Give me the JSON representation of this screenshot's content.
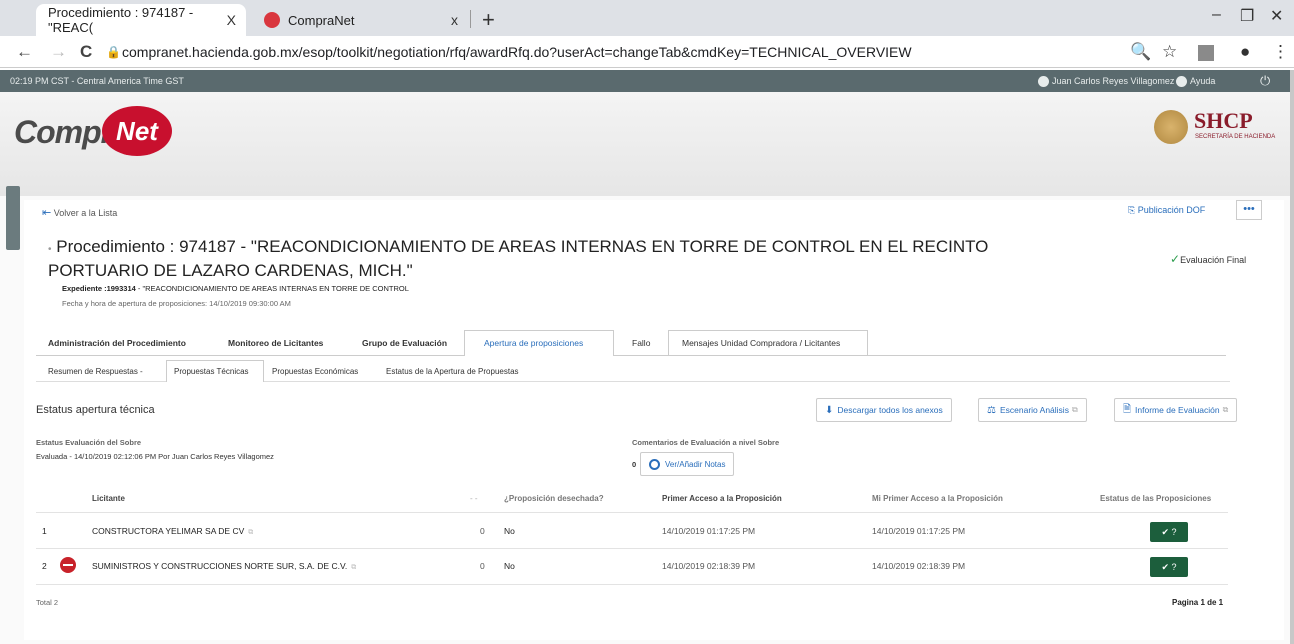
{
  "browser": {
    "tabs": [
      {
        "title": "Procedimiento : 974187 - \"REAC(",
        "close": "X"
      },
      {
        "title": "CompraNet",
        "close": "x"
      }
    ],
    "new_tab": "+",
    "window_controls": {
      "minimize": "‒",
      "restore": "❐",
      "close": "✕"
    },
    "nav": {
      "back": "←",
      "forward": "→",
      "reload": "C"
    },
    "url": "compranet.hacienda.gob.mx/esop/toolkit/negotiation/rfq/awardRfq.do?userAct=changeTab&cmdKey=TECHNICAL_OVERVIEW",
    "icons": {
      "search": "🔍",
      "star": "☆",
      "profile": "●",
      "menu": "⋮"
    }
  },
  "topstrip": {
    "time": "02:19 PM CST - Central America Time GST",
    "user": "Juan Carlos Reyes Villagomez",
    "help": "Ayuda",
    "power": "⏻"
  },
  "header": {
    "logo_left": "Compra",
    "logo_net": "Net",
    "agency": "SHCP",
    "agency_sub": "SECRETARÍA DE HACIENDA"
  },
  "nav": {
    "back_label": "Volver a la Lista",
    "publication": "Publicación DOF",
    "more": "•••"
  },
  "procedure": {
    "title": "Procedimiento : 974187 - \"REACONDICIONAMIENTO DE AREAS INTERNAS EN TORRE DE CONTROL EN EL RECINTO PORTUARIO DE LAZARO CARDENAS, MICH.\"",
    "status": "Evaluación Final",
    "exp_label": "Expediente :1993314",
    "exp_value": " - \"REACONDICIONAMIENTO DE AREAS INTERNAS EN TORRE DE CONTROL",
    "fecha": "Fecha y hora de apertura de proposiciones: 14/10/2019 09:30:00 AM"
  },
  "tabs": [
    "Administración del Procedimiento",
    "Monitoreo de Licitantes",
    "Grupo de Evaluación",
    "Apertura de proposiciones",
    "Fallo",
    "Mensajes Unidad Compradora / Licitantes"
  ],
  "subtabs": [
    "Resumen de Respuestas -",
    "Propuestas Técnicas",
    "Propuestas Económicas",
    "Estatus de la Apertura de Propuestas"
  ],
  "section": {
    "title": "Estatus apertura técnica",
    "btn_download": "Descargar todos los anexos",
    "btn_scenario": "Escenario Análisis",
    "btn_report": "Informe de Evaluación"
  },
  "evaluation": {
    "label": "Estatus Evaluación del Sobre",
    "value": "Evaluada - 14/10/2019 02:12:06 PM  Por Juan Carlos Reyes Villagomez",
    "comments_label": "Comentarios de Evaluación a nivel Sobre",
    "comments_count": "0",
    "notes_btn": "Ver/Añadir Notas"
  },
  "table": {
    "headers": {
      "licitante": "Licitante",
      "dash": "- -",
      "desechada": "¿Proposición desechada?",
      "primer_acceso": "Primer Acceso a la Proposición",
      "mi_primer_acceso": "Mi Primer Acceso a la Proposición",
      "estatus": "Estatus de las Proposiciones"
    },
    "rows": [
      {
        "num": "1",
        "name": "CONSTRUCTORA YELIMAR SA DE CV",
        "count": "0",
        "desechada": "No",
        "primer": "14/10/2019 01:17:25 PM",
        "mi_primer": "14/10/2019 01:17:25 PM",
        "btn": "✔ ?"
      },
      {
        "num": "2",
        "name": "SUMINISTROS Y CONSTRUCCIONES NORTE SUR, S.A. DE C.V.",
        "count": "0",
        "desechada": "No",
        "primer": "14/10/2019 02:18:39 PM",
        "mi_primer": "14/10/2019 02:18:39 PM",
        "btn": "✔ ?"
      }
    ],
    "total": "Total 2",
    "pagina": "Pagina 1 de 1"
  }
}
